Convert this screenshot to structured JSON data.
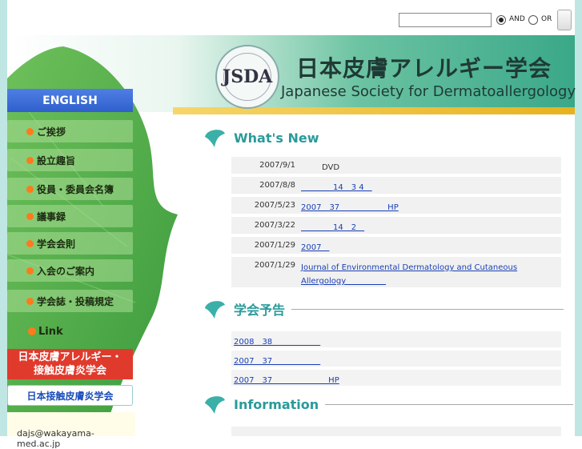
{
  "search": {
    "value": "",
    "and_label": "AND",
    "or_label": "OR",
    "button_label": ""
  },
  "header": {
    "logo_text": "JSDA",
    "title_ja": "日本皮膚アレルギー学会",
    "title_en": "Japanese Society for Dermatoallergology"
  },
  "sidebar": {
    "english": "ENGLISH",
    "items": [
      {
        "label": "ご挨拶"
      },
      {
        "label": "設立趣旨"
      },
      {
        "label": "役員・委員会名簿"
      },
      {
        "label": "議事録"
      },
      {
        "label": "学会会則"
      },
      {
        "label": "入会のご案内"
      },
      {
        "label": "学会誌・投稿規定"
      }
    ],
    "link_label": "Link",
    "red_button_line1": "日本皮膚アレルギー・",
    "red_button_line2": "接触皮膚炎学会",
    "white_button": "日本接触皮膚炎学会",
    "email": "dajs@wakayama-med.ac.jp"
  },
  "sections": {
    "whats_new": "What's New",
    "announcements": "学会予告",
    "information": "Information"
  },
  "news": [
    {
      "date": "2007/9/1",
      "text": "DVD",
      "link": false
    },
    {
      "date": "2007/8/8",
      "text": "　　　　14　3 4　",
      "link": true
    },
    {
      "date": "2007/5/23",
      "text": "2007　37　　　　　　HP",
      "link": true
    },
    {
      "date": "2007/3/22",
      "text": "　　　　14　2　",
      "link": true
    },
    {
      "date": "2007/1/29",
      "text": "2007　",
      "link": true
    },
    {
      "date": "2007/1/29",
      "text": "Journal of Environmental Dermatology and Cutaneous Allergology　　　　　",
      "link": true
    }
  ],
  "announcements": [
    {
      "text": "2008　38　　　　　　"
    },
    {
      "text": "2007　37　　　　　　"
    },
    {
      "text": "2007　37　　　　　　　HP"
    }
  ],
  "colors": {
    "accent": "#2a9a9a",
    "link": "#1a3fb5",
    "english_btn": "#3a68d2",
    "red_btn": "#e03a2c",
    "dot": "#ff7a1a"
  }
}
